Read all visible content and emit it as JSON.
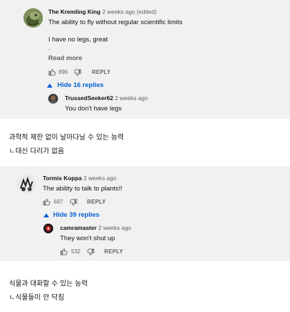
{
  "thread1": {
    "comment": {
      "author": "The Kremling King",
      "meta": "2 weeks ago (edited)",
      "line1": "The ability to fly without regular scientific limits",
      "line2": "I have no legs, great",
      "line3": "-",
      "read_more": "Read more",
      "likes": "890",
      "reply_label": "REPLY"
    },
    "hide_replies": "Hide 16 replies",
    "reply": {
      "author": "TrussedSeeker62",
      "meta": "2 weeks ago",
      "text": "You don't have legs"
    }
  },
  "caption1": {
    "line1": "과학적 제한 없이 날아다닐 수 있는 능력",
    "line2": "ㄴ대신 다리가 없음"
  },
  "thread2": {
    "comment": {
      "author": "Tormis Koppa",
      "meta": "2 weeks ago",
      "text": "The ability to talk to plants!!",
      "likes": "697",
      "reply_label": "REPLY"
    },
    "hide_replies": "Hide 39 replies",
    "reply": {
      "author": "camramaster",
      "meta": "2 weeks ago",
      "text": "They won't shut up",
      "likes": "532",
      "reply_label": "REPLY"
    }
  },
  "caption2": {
    "line1": "식물과 대화할 수 있는 능력",
    "line2": "ㄴ식물들이 안 닥침"
  },
  "colors": {
    "link_blue": "#065fd4",
    "meta_gray": "#606060",
    "panel_bg": "#f1f1f1"
  },
  "icons": [
    "thumbs-up-icon",
    "thumbs-down-icon",
    "caret-up-icon"
  ]
}
